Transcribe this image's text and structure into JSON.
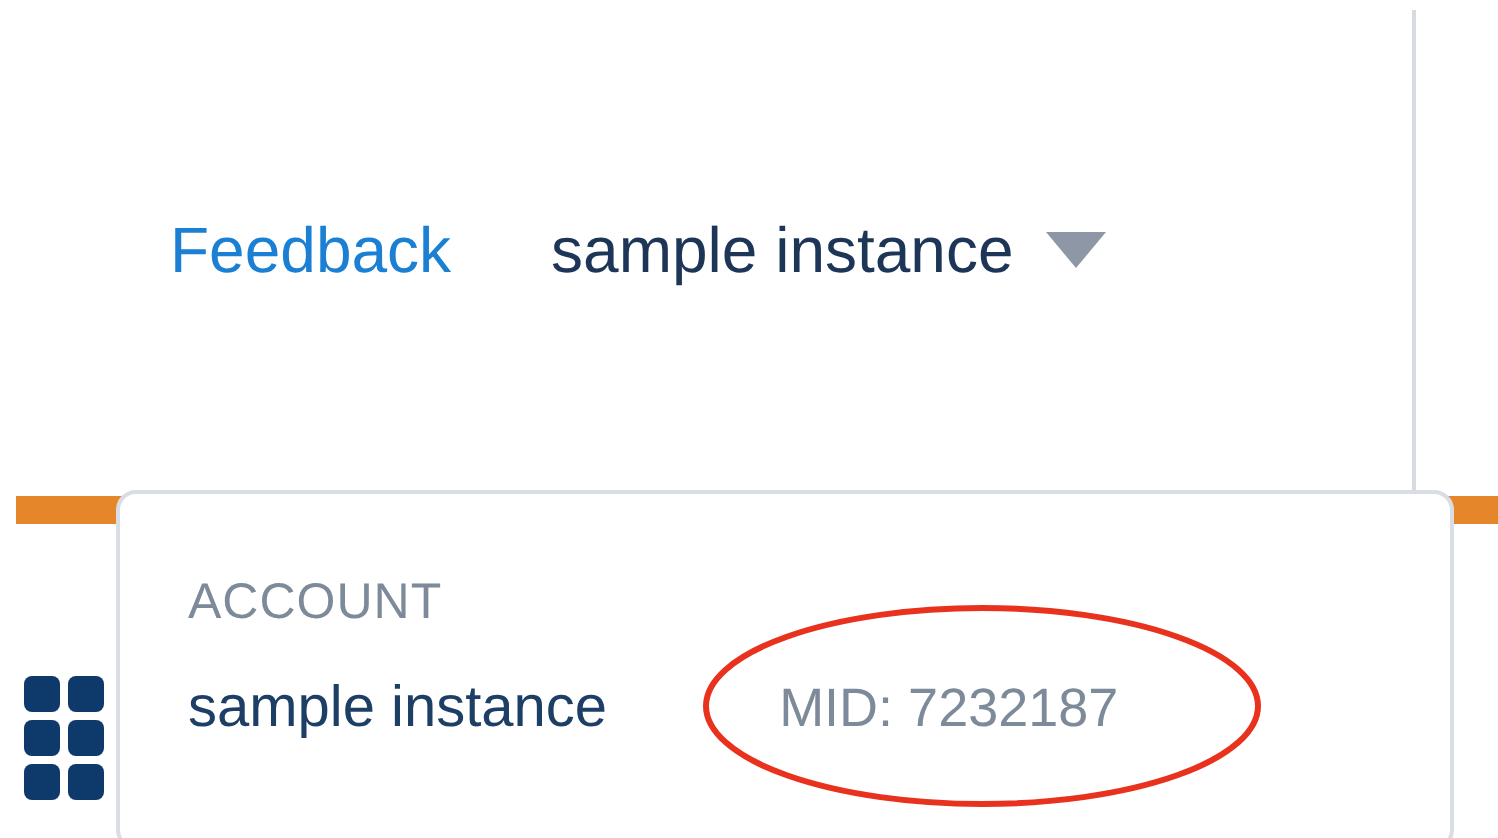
{
  "header": {
    "feedback_link": "Feedback",
    "instance_menu": {
      "label": "sample instance",
      "expanded": true
    }
  },
  "account_dropdown": {
    "heading": "ACCOUNT",
    "account_name": "sample instance",
    "mid": "MID: 7232187",
    "highlighted": true
  }
}
